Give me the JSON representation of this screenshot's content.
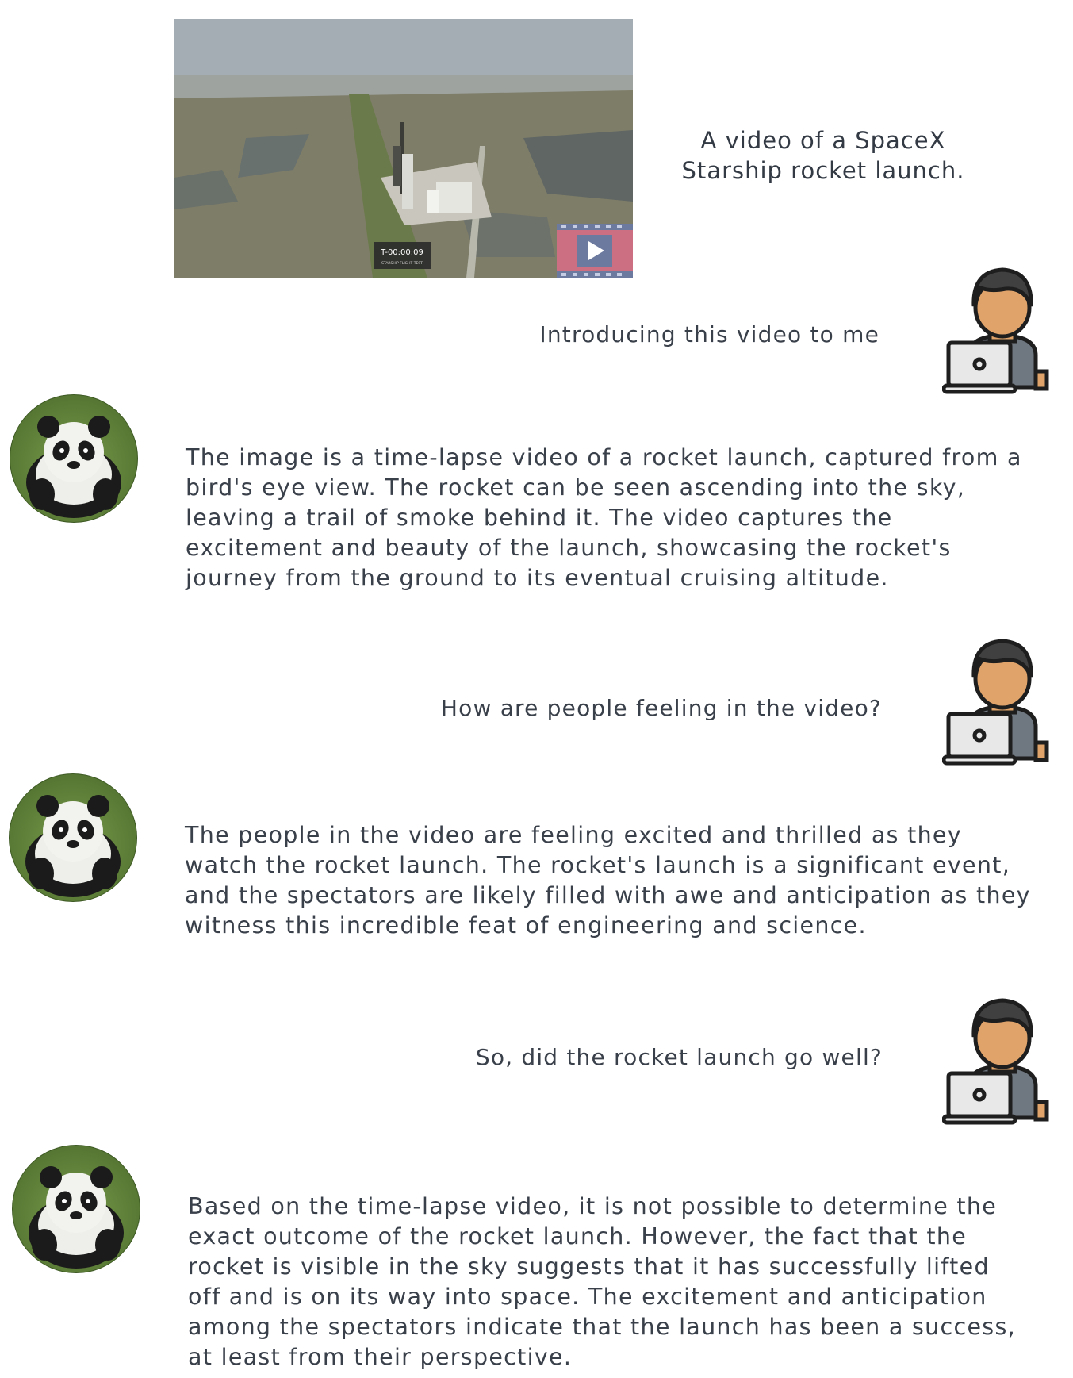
{
  "video": {
    "timecode": "T-00:00:09",
    "subtitle": "STARSHIP FLIGHT TEST",
    "icon": "play-video-icon",
    "caption": "A video of a SpaceX Starship rocket launch."
  },
  "messages": [
    {
      "role": "user",
      "text": "Introducing this video to me"
    },
    {
      "role": "assistant",
      "text": "The image is a time-lapse video of a rocket launch, captured from a bird's eye view. The rocket can be seen ascending into the sky, leaving a trail of smoke behind it. The video captures the excitement and beauty of the launch, showcasing the rocket's journey from the ground to its eventual cruising altitude."
    },
    {
      "role": "user",
      "text": "How are people feeling in the video?"
    },
    {
      "role": "assistant",
      "text": "The people in the video are feeling excited and thrilled as they watch the rocket launch. The rocket's launch is a significant event, and the spectators are likely filled with awe and anticipation as they witness this incredible feat of engineering and science."
    },
    {
      "role": "user",
      "text": "So, did the rocket launch go well?"
    },
    {
      "role": "assistant",
      "text": "Based on the time-lapse video, it is not possible to determine the exact outcome of the rocket launch. However, the fact that the rocket is visible in the sky suggests that it has successfully lifted off and is on its way into space. The excitement and anticipation among the spectators indicate that the launch has been a success, at least from their perspective."
    }
  ],
  "avatars": {
    "user_icon": "user-laptop-icon",
    "assistant_icon": "panda-avatar-icon"
  },
  "colors": {
    "text": "#3a404a",
    "user_skin": "#e0a46b",
    "user_hair": "#404040",
    "user_shirt": "#6f7780"
  }
}
